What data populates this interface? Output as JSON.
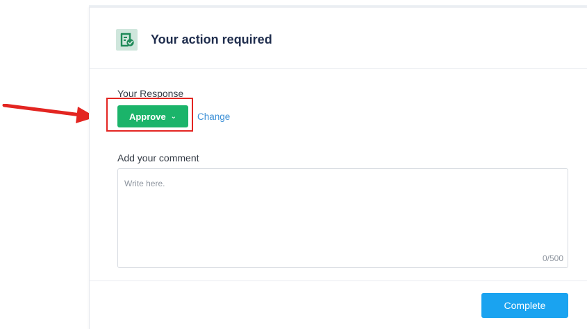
{
  "card": {
    "title": "Your action required",
    "icon": "approval-checklist-icon"
  },
  "response": {
    "label": "Your Response",
    "selected_value": "Approve",
    "change_link": "Change"
  },
  "comment": {
    "label": "Add your comment",
    "placeholder": "Write here.",
    "value": "",
    "counter": "0/500"
  },
  "footer": {
    "complete_label": "Complete"
  },
  "annotation": {
    "arrow_color": "#e32521",
    "highlight_color": "#e32521"
  },
  "colors": {
    "approve_green": "#1bb46a",
    "complete_blue": "#1aa3f0",
    "link_blue": "#3b8fd6",
    "title_navy": "#1f2d4d"
  }
}
